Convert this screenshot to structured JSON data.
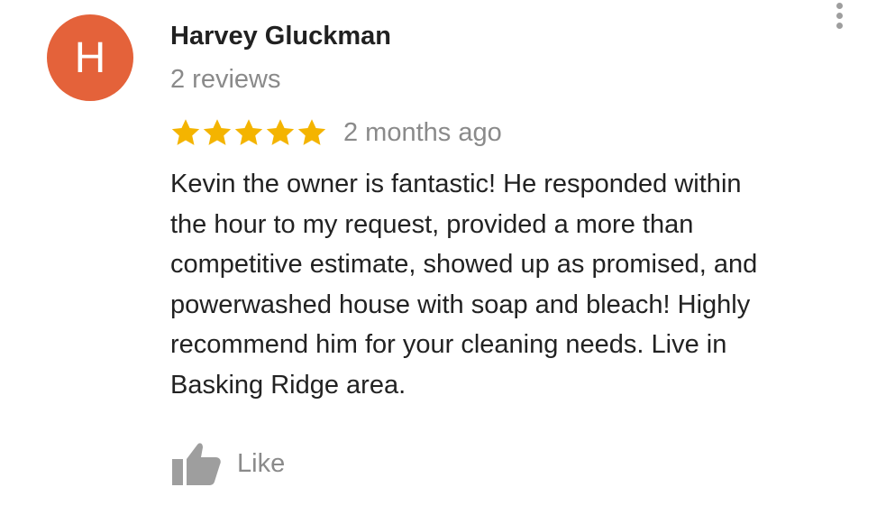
{
  "review": {
    "avatar_initial": "H",
    "author_name": "Harvey Gluckman",
    "review_count": "2 reviews",
    "rating": 5,
    "rating_max": 5,
    "date": "2 months ago",
    "text": "Kevin the owner is fantastic!  He responded within\nthe hour to my request,  provided a more than\ncompetitive estimate, showed up as promised, and\npowerwashed house with soap and bleach!  Highly\nrecommend him for your cleaning needs.  Live in\nBasking Ridge area.",
    "like_label": "Like"
  },
  "icons": {
    "menu": "more-vertical-icon",
    "star": "star-icon",
    "like": "thumbs-up-icon"
  },
  "colors": {
    "avatar_bg": "#e4623a",
    "star": "#f4b400",
    "secondary_text": "#8a8a8a",
    "primary_text": "#222222"
  }
}
